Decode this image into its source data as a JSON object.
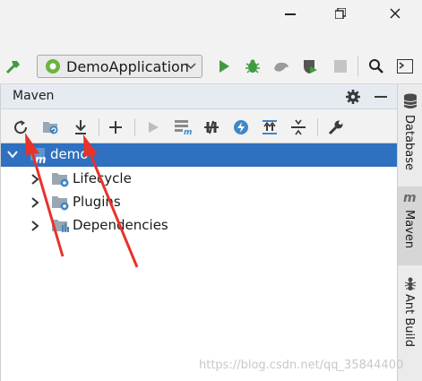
{
  "run_config": {
    "label": "DemoApplication"
  },
  "maven_panel": {
    "title": "Maven",
    "tree": [
      {
        "label": "demo",
        "selected": true
      },
      {
        "label": "Lifecycle"
      },
      {
        "label": "Plugins"
      },
      {
        "label": "Dependencies"
      }
    ]
  },
  "side_tabs": [
    {
      "label": "Database"
    },
    {
      "label": "Maven",
      "active": true
    },
    {
      "label": "Ant Build"
    }
  ],
  "watermark": "https://blog.csdn.net/qq_35844400",
  "colors": {
    "selection": "#2f70c0",
    "run_green": "#3f9b3f",
    "arrow_red": "#e8322b",
    "panel_header": "#e6ebf2"
  },
  "icons": [
    "minimize-icon",
    "maximize-icon",
    "close-icon",
    "build-hammer-icon",
    "spring-boot-icon",
    "chevron-down-icon",
    "run-icon",
    "debug-icon",
    "coverage-icon",
    "profiler-icon",
    "stop-icon",
    "search-icon",
    "terminal-icon",
    "gear-icon",
    "hide-icon",
    "reload-icon",
    "generate-sources-icon",
    "download-icon",
    "add-icon",
    "execute-goal-icon",
    "run-maven-build-icon",
    "toggle-offline-icon",
    "skip-tests-icon",
    "show-dependencies-icon",
    "collapse-all-icon",
    "settings-wrench-icon",
    "maven-module-icon",
    "folder-gear-icon",
    "folder-bars-icon",
    "database-icon",
    "maven-tab-icon",
    "ant-icon"
  ]
}
